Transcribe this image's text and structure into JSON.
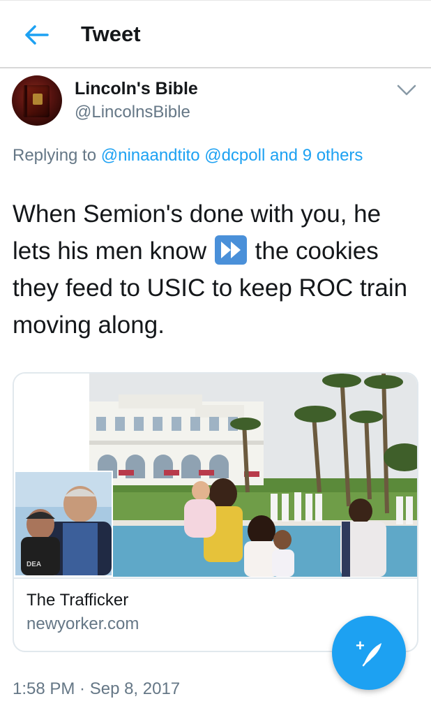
{
  "header": {
    "title": "Tweet",
    "back_icon": "arrow-left-icon",
    "accent": "#1da1f2"
  },
  "author": {
    "name": "Lincoln's Bible",
    "handle": "@LincolnsBible",
    "avatar_icon": "book-avatar",
    "menu_icon": "chevron-down-icon"
  },
  "reply": {
    "prefix": "Replying to",
    "mentions": [
      "@ninaandtito",
      "@dcpoll"
    ],
    "joiner": "and",
    "others": "9 others"
  },
  "tweet": {
    "text_before": "When Semion's done with you, he lets his men know",
    "emoji_icon": "fast-forward-icon",
    "text_after": "the cookies they feed to USIC to keep ROC train moving along."
  },
  "card": {
    "title": "The Trafficker",
    "domain": "newyorker.com",
    "image_icon": "article-photo",
    "inset_text": "DEA"
  },
  "timestamp": "1:58 PM · Sep 8, 2017",
  "compose": {
    "icon": "compose-feather-icon",
    "plus": "+"
  },
  "colors": {
    "text": "#14171a",
    "secondary": "#657786",
    "link": "#1da1f2",
    "border": "#e1e8ed"
  }
}
